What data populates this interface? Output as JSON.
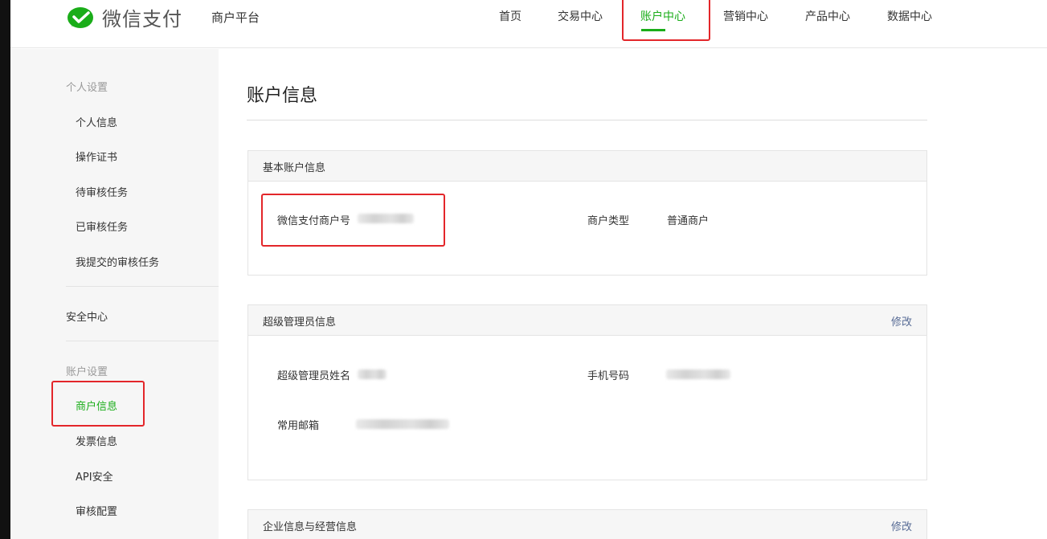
{
  "header": {
    "brand": "微信支付",
    "platform": "商户平台",
    "nav": [
      {
        "label": "首页"
      },
      {
        "label": "交易中心"
      },
      {
        "label": "账户中心",
        "active": true
      },
      {
        "label": "营销中心"
      },
      {
        "label": "产品中心"
      },
      {
        "label": "数据中心"
      }
    ]
  },
  "sidebar": {
    "personal_group": "个人设置",
    "personal_items": [
      "个人信息",
      "操作证书",
      "待审核任务",
      "已审核任务",
      "我提交的审核任务"
    ],
    "security": "安全中心",
    "account_group": "账户设置",
    "account_items": [
      "商户信息",
      "发票信息",
      "API安全",
      "审核配置"
    ]
  },
  "main": {
    "title": "账户信息",
    "basic": {
      "title": "基本账户信息",
      "merchant_id_label": "微信支付商户号",
      "merchant_type_label": "商户类型",
      "merchant_type_value": "普通商户"
    },
    "admin": {
      "title": "超级管理员信息",
      "action": "修改",
      "name_label": "超级管理员姓名",
      "phone_label": "手机号码",
      "email_label": "常用邮箱"
    },
    "company": {
      "title": "企业信息与经营信息",
      "action": "修改"
    }
  },
  "colors": {
    "accent": "#1aad19",
    "link": "#576b95",
    "highlight_box": "#e3262a"
  }
}
